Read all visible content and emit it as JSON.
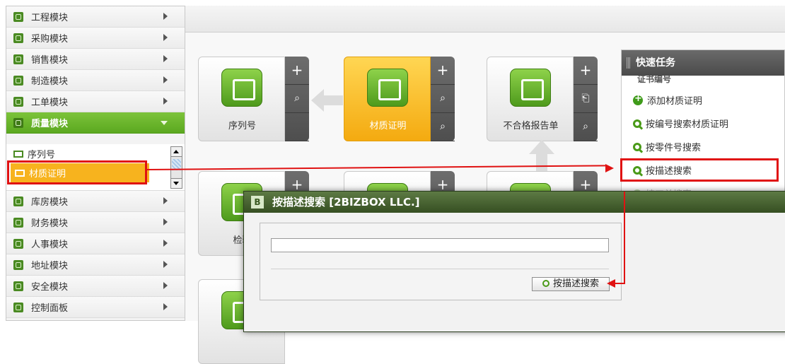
{
  "sidebar": {
    "modules_top": [
      {
        "label": "工程模块"
      },
      {
        "label": "采购模块"
      },
      {
        "label": "销售模块"
      },
      {
        "label": "制造模块"
      },
      {
        "label": "工单模块"
      }
    ],
    "active_module": {
      "label": "质量模块"
    },
    "sub_items": [
      {
        "label": "序列号"
      },
      {
        "label": "材质证明"
      }
    ],
    "modules_bottom": [
      {
        "label": "库房模块"
      },
      {
        "label": "财务模块"
      },
      {
        "label": "人事模块"
      },
      {
        "label": "地址模块"
      },
      {
        "label": "安全模块"
      },
      {
        "label": "控制面板"
      }
    ]
  },
  "tiles": [
    {
      "caption": "序列号"
    },
    {
      "caption": "材质证明"
    },
    {
      "caption": "不合格报告单"
    },
    {
      "caption": "检验"
    }
  ],
  "quick_tasks": {
    "title": "快速任务",
    "section": "证书编号",
    "items": [
      {
        "label": "添加材质证明"
      },
      {
        "label": "按编号搜索材质证明"
      },
      {
        "label": "按零件号搜索"
      },
      {
        "label": "按描述搜索"
      },
      {
        "label": "按工单搜索"
      }
    ]
  },
  "dialog": {
    "logo": "B",
    "title": "按描述搜索 [2BIZBOX LLC.]",
    "input_value": "",
    "button_label": "按描述搜索"
  },
  "colors": {
    "accent_green": "#5ba820",
    "highlight_orange": "#f7b31e",
    "annotation_red": "#e01212"
  }
}
